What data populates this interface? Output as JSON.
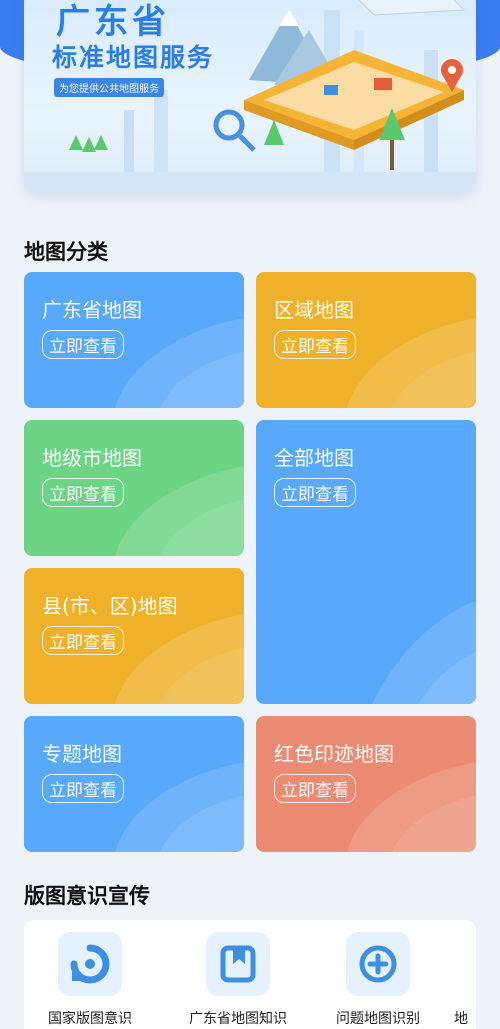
{
  "hero": {
    "title": "广东省",
    "subtitle": "标准地图服务",
    "tagline": "为您提供公共地图服务"
  },
  "categories_section": {
    "title": "地图分类",
    "view_label": "立即查看",
    "cards": [
      {
        "title": "广东省地图",
        "color": "#58a8fb"
      },
      {
        "title": "区域地图",
        "color": "#efb12a"
      },
      {
        "title": "地级市地图",
        "color": "#6ed485"
      },
      {
        "title": "全部地图",
        "color": "#58a8fb"
      },
      {
        "title": "县(市、区)地图",
        "color": "#efb12a"
      },
      {
        "title": "专题地图",
        "color": "#58a8fb"
      },
      {
        "title": "红色印迹地图",
        "color": "#ec8b73"
      }
    ]
  },
  "awareness_section": {
    "title": "版图意识宣传",
    "items": [
      {
        "label": "国家版图意识",
        "icon": "refresh-map-icon"
      },
      {
        "label": "广东省地图知识",
        "icon": "bookmark-book-icon"
      },
      {
        "label": "问题地图识别",
        "icon": "add-circle-icon"
      },
      {
        "label": "地",
        "icon": "partial-icon"
      }
    ]
  }
}
